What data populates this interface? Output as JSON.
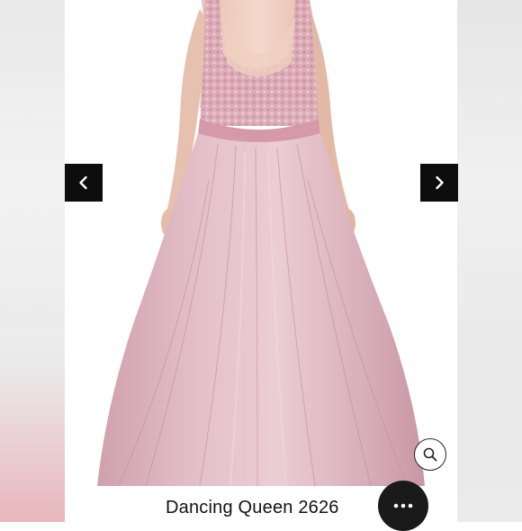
{
  "product": {
    "title": "Dancing Queen 2626"
  },
  "icons": {
    "prev": "chevron-left-icon",
    "next": "chevron-right-icon",
    "zoom": "magnifier-icon",
    "chat": "ellipsis-chat-icon"
  },
  "colors": {
    "dress": "#d7aab6",
    "arrow_bg": "#0d0d0d",
    "chat_bg": "#1a1a1a"
  }
}
